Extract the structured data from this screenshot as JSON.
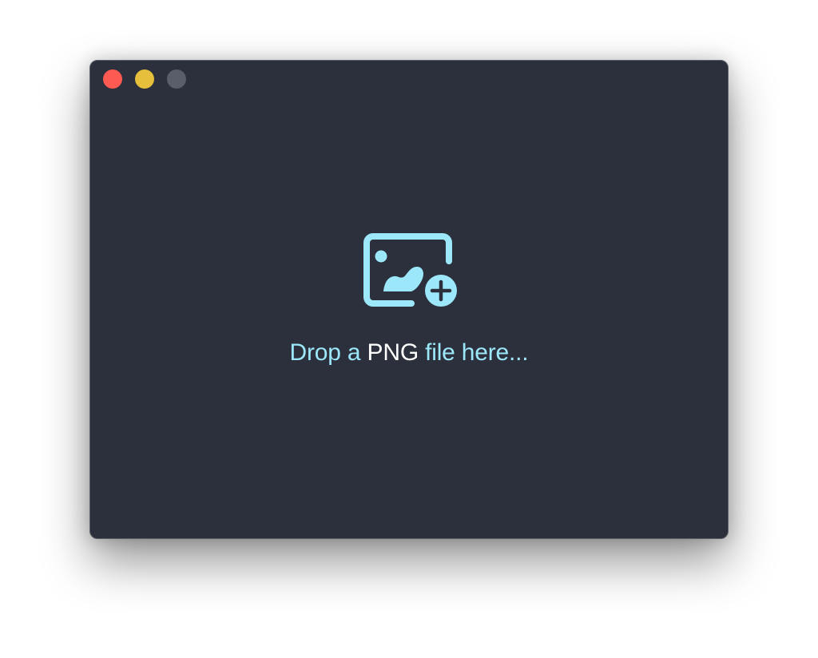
{
  "window": {
    "background": "#2b303c",
    "controls": [
      {
        "name": "close",
        "color": "#fd5b51"
      },
      {
        "name": "minimize",
        "color": "#e6bf3c"
      },
      {
        "name": "zoom",
        "color": "#5a5e6a"
      }
    ]
  },
  "drop_zone": {
    "icon": "image-add-icon",
    "accent_color": "#9ce7f9",
    "highlight_color": "#ffffff",
    "message_prefix": "Drop a",
    "message_highlight": "PNG",
    "message_suffix": "file here..."
  }
}
